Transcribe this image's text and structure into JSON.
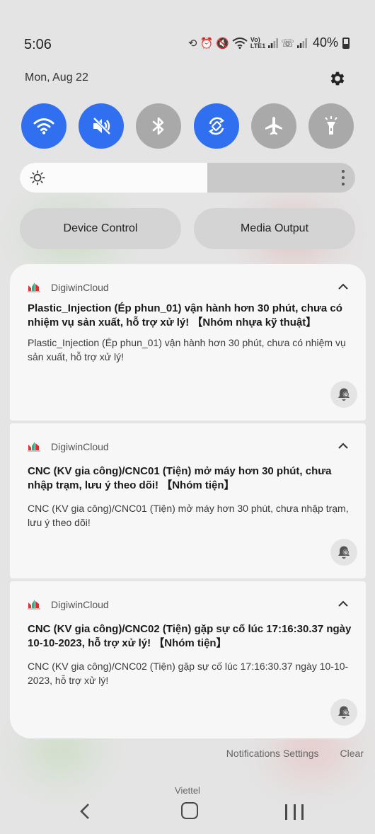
{
  "status_bar": {
    "time": "5:06",
    "icons": [
      "sync-icon",
      "alarm-icon",
      "mute-icon",
      "wifi-icon",
      "volte-icon",
      "signal-icon",
      "wifi-calling-icon",
      "signal-icon"
    ],
    "battery": "40%"
  },
  "quick_panel": {
    "date": "Mon, Aug 22",
    "toggles": [
      {
        "name": "wifi",
        "state": "on"
      },
      {
        "name": "sound-mute",
        "state": "on"
      },
      {
        "name": "bluetooth",
        "state": "off"
      },
      {
        "name": "auto-rotate",
        "state": "on"
      },
      {
        "name": "airplane-mode",
        "state": "off"
      },
      {
        "name": "flashlight",
        "state": "off"
      }
    ],
    "brightness_level": 0.56,
    "device_control_label": "Device Control",
    "media_output_label": "Media Output"
  },
  "notifications": [
    {
      "app": "DigiwinCloud",
      "title": "Plastic_Injection (Ép phun_01) vận hành hơn 30 phút, chưa có nhiệm vụ sản xuất, hỗ trợ xử lý! 【Nhóm nhựa kỹ thuật】",
      "body": "Plastic_Injection (Ép phun_01) vận hành hơn 30 phút, chưa có nhiệm vụ sản xuất, hỗ trợ xử lý!"
    },
    {
      "app": "DigiwinCloud",
      "title": "CNC (KV gia công)/CNC01 (Tiện) mở máy hơn 30 phút, chưa nhập trạm, lưu ý theo dõi! 【Nhóm tiện】",
      "body": "CNC (KV gia công)/CNC01 (Tiện) mở máy hơn 30 phút, chưa nhập trạm, lưu ý theo dõi!"
    },
    {
      "app": "DigiwinCloud",
      "title": "CNC (KV gia công)/CNC02 (Tiện) gặp sự cố lúc 17:16:30.37 ngày 10-10-2023, hỗ trợ xử lý! 【Nhóm tiện】",
      "body": "CNC (KV gia công)/CNC02 (Tiện) gặp sự cố lúc 17:16:30.37 ngày 10-10-2023, hỗ trợ xử lý!"
    }
  ],
  "footer": {
    "settings_label": "Notifications Settings",
    "clear_label": "Clear",
    "carrier": "Viettel"
  },
  "colors": {
    "toggle_on": "#2f6ff0",
    "toggle_off": "#a9a9a9",
    "card": "#f7f7f7"
  }
}
